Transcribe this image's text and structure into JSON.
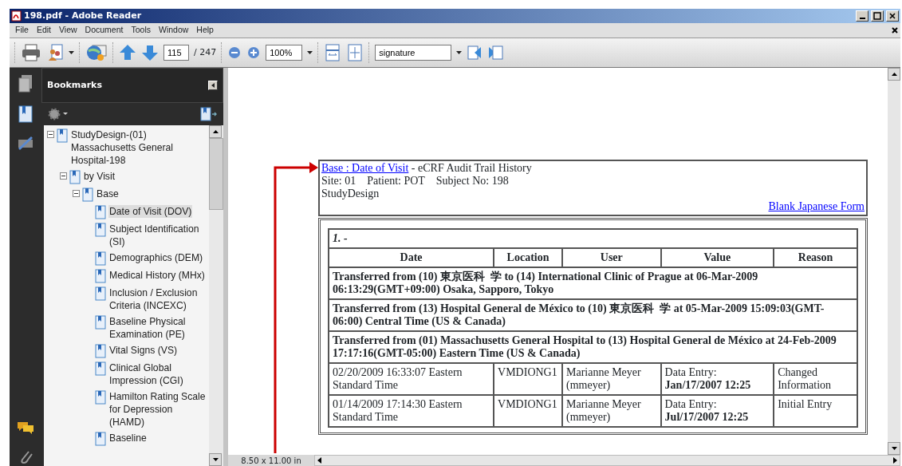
{
  "window": {
    "title": "198.pdf - Adobe Reader"
  },
  "menu": [
    "File",
    "Edit",
    "View",
    "Document",
    "Tools",
    "Window",
    "Help"
  ],
  "toolbar": {
    "page": "115",
    "page_count": "/ 247",
    "zoom": "100%",
    "search": "signature"
  },
  "bookmarks": {
    "title": "Bookmarks",
    "items": [
      {
        "label": "StudyDesign-(01) Massachusetts General Hospital-198",
        "expanded": true,
        "selected": false,
        "children": [
          {
            "label": "by Visit",
            "expanded": true,
            "selected": false,
            "children": [
              {
                "label": "Base",
                "expanded": true,
                "selected": false,
                "children": [
                  {
                    "label": "Date of Visit (DOV)",
                    "selected": true
                  },
                  {
                    "label": "Subject Identification (SI)",
                    "selected": false
                  },
                  {
                    "label": "Demographics (DEM)",
                    "selected": false
                  },
                  {
                    "label": "Medical History (MHx)",
                    "selected": false
                  },
                  {
                    "label": "Inclusion / Exclusion Criteria (INCEXC)",
                    "selected": false
                  },
                  {
                    "label": "Baseline Physical Examination (PE)",
                    "selected": false
                  },
                  {
                    "label": "Vital Signs (VS)",
                    "selected": false
                  },
                  {
                    "label": "Clinical Global Impression (CGI)",
                    "selected": false
                  },
                  {
                    "label": "Hamilton Rating Scale for Depression (HAMD)",
                    "selected": false
                  },
                  {
                    "label": "Baseline",
                    "selected": false
                  }
                ]
              }
            ]
          }
        ]
      }
    ]
  },
  "document": {
    "link": "Base : Date of Visit",
    "title": " - eCRF Audit Trail History",
    "info": "Site: 01    Patient: POT    Subject No: 198",
    "study": "StudyDesign",
    "form_link": "Blank Japanese Form",
    "section": "1. -",
    "columns": [
      "Date",
      "Location",
      "User",
      "Value",
      "Reason"
    ],
    "transfers": [
      "Transferred from (10) 東京医科  学 to (14) International Clinic of Prague at 06-Mar-2009 06:13:29(GMT+09:00) Osaka, Sapporo, Tokyo",
      "Transferred from (13) Hospital General de México to (10) 東京医科  学 at 05-Mar-2009 15:09:03(GMT-06:00) Central Time (US & Canada)",
      "Transferred from (01) Massachusetts General Hospital to (13) Hospital General de México at 24-Feb-2009 17:17:16(GMT-05:00) Eastern Time (US & Canada)"
    ],
    "rows": [
      {
        "date": "02/20/2009 16:33:07 Eastern Standard Time",
        "location": "VMDIONG1",
        "user": "Marianne Meyer (mmeyer)",
        "value_label": "Data Entry:",
        "value_date": "Jan/17/2007 12:25",
        "reason": "Changed Information"
      },
      {
        "date": "01/14/2009 17:14:30 Eastern Standard Time",
        "location": "VMDIONG1",
        "user": "Marianne Meyer (mmeyer)",
        "value_label": "Data Entry:",
        "value_date": "Jul/17/2007 12:25",
        "reason": "Initial Entry"
      }
    ]
  },
  "status_bar": {
    "page_size": "8.50 x 11.00 in"
  }
}
